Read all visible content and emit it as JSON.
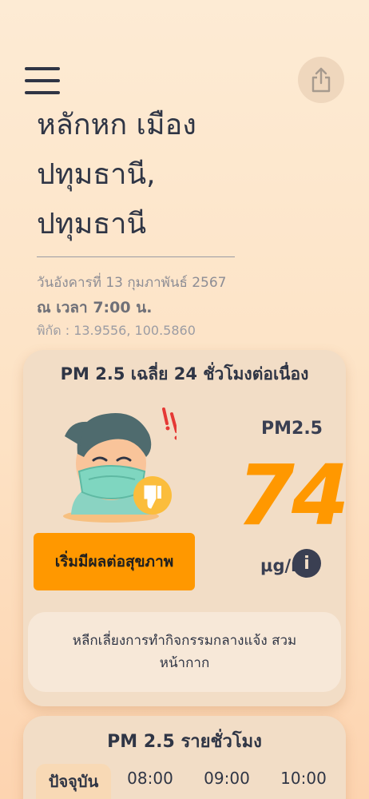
{
  "header": {
    "location_line1": "หลักหก เมือง",
    "location_line2": "ปทุมธานี,",
    "location_line3": "ปทุมธานี",
    "date": "วันอังคารที่ 13 กุมภาพันธ์ 2567",
    "time": "ณ เวลา 7:00 น.",
    "coords": "พิกัด : 13.9556, 100.5860"
  },
  "icons": {
    "menu": "hamburger-menu-icon",
    "share": "share-icon",
    "info": "info-icon",
    "mascot": "masked-face-icon",
    "thumb": "thumbs-down-icon"
  },
  "pm24": {
    "title": "PM 2.5 เฉลี่ย 24 ชั่วโมงต่อเนื่อง",
    "label": "PM2.5",
    "value": "74",
    "unit": "μg/m³",
    "level_label": "เริ่มมีผลต่อสุขภาพ",
    "advice": "หลีกเลี่ยงการทำกิจกรรมกลางแจ้ง สวมหน้ากาก",
    "colors": {
      "level": "#ff9800",
      "value": "#ff9800"
    }
  },
  "hourly": {
    "title": "PM 2.5 รายชั่วโมง",
    "hours": [
      "ปัจจุบัน",
      "08:00",
      "09:00",
      "10:00"
    ]
  }
}
